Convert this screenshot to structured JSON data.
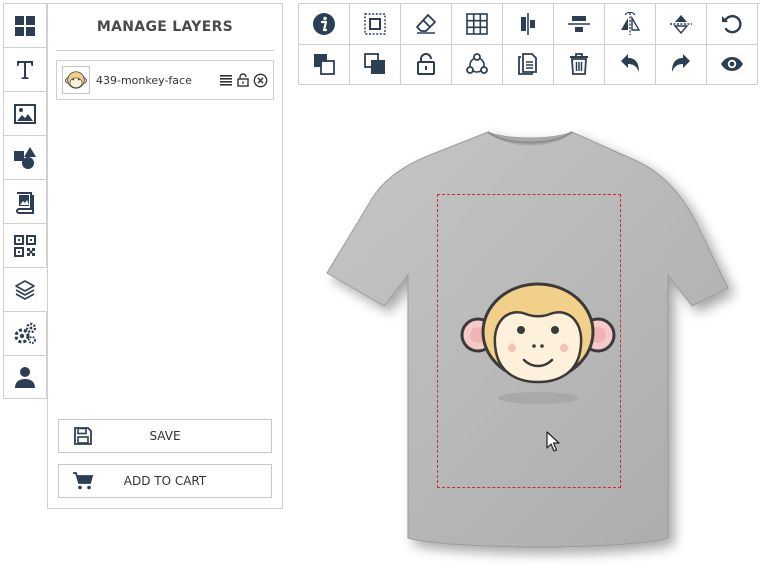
{
  "sidebar": {
    "items": [
      {
        "name": "grid-icon"
      },
      {
        "name": "text-icon"
      },
      {
        "name": "image-icon"
      },
      {
        "name": "shapes-icon"
      },
      {
        "name": "clipart-icon"
      },
      {
        "name": "qr-code-icon"
      },
      {
        "name": "layers-icon",
        "active": true
      },
      {
        "name": "settings-icon"
      },
      {
        "name": "user-icon"
      }
    ]
  },
  "panel": {
    "title": "MANAGE LAYERS",
    "layers": [
      {
        "name": "439-monkey-face"
      }
    ],
    "save_label": "SAVE",
    "add_to_cart_label": "ADD TO CART"
  },
  "toolbar": {
    "row1": [
      "info-icon",
      "select-icon",
      "eraser-icon",
      "grid-lines-icon",
      "align-vertical-center-icon",
      "align-horizontal-center-icon",
      "flip-horizontal-icon",
      "flip-vertical-icon",
      "reset-icon"
    ],
    "row2": [
      "bring-forward-icon",
      "send-backward-icon",
      "lock-icon",
      "group-icon",
      "duplicate-icon",
      "delete-icon",
      "undo-icon",
      "redo-icon",
      "preview-icon"
    ]
  },
  "colors": {
    "icon": "#2c3e55",
    "tshirt": "#b9b9b9",
    "design_border": "#c9302c",
    "monkey_fur": "#f2d089",
    "monkey_face": "#fdf1dc"
  }
}
